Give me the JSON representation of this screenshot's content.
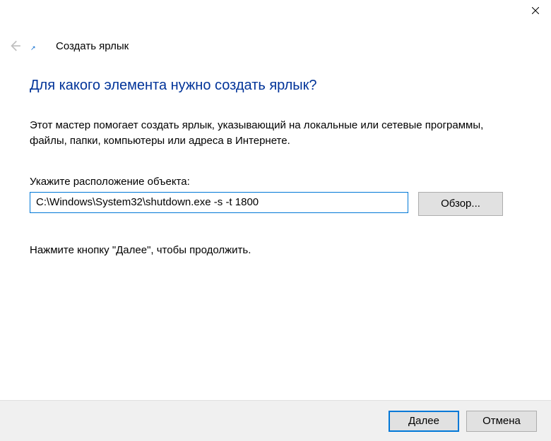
{
  "titlebar": {
    "close_label": "Close"
  },
  "header": {
    "wizard_title": "Создать ярлык"
  },
  "main": {
    "heading": "Для какого элемента нужно создать ярлык?",
    "description": "Этот мастер помогает создать ярлык, указывающий на локальные или сетевые программы, файлы, папки, компьютеры или адреса в Интернете.",
    "field_label": "Укажите расположение объекта:",
    "location_value": "C:\\Windows\\System32\\shutdown.exe -s -t 1800",
    "browse_label": "Обзор...",
    "instruction": "Нажмите кнопку \"Далее\", чтобы продолжить."
  },
  "footer": {
    "next_label": "Далее",
    "cancel_label": "Отмена"
  }
}
